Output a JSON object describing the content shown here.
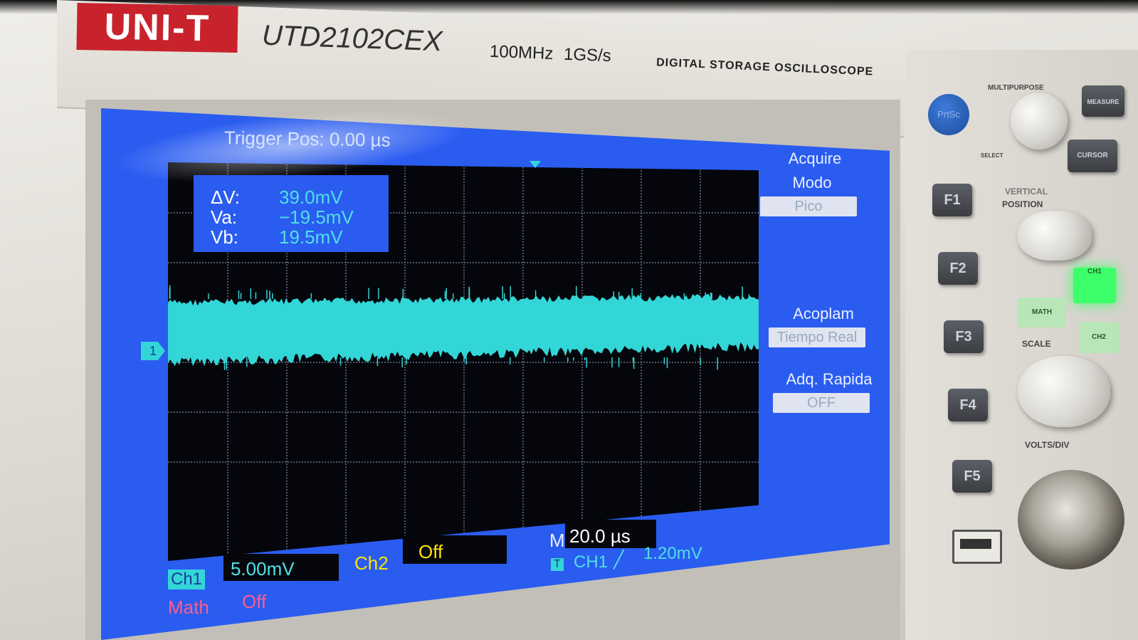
{
  "device": {
    "brand": "UNI-T",
    "model": "UTD2102CEX",
    "spec": "100MHz 1GS/s",
    "kind": "DIGITAL STORAGE OSCILLOSCOPE"
  },
  "screen": {
    "trigger_time": "Trigger Pos: 0.00 µs",
    "cursor": {
      "dv_label": "ΔV:",
      "dv_value": "39.0mV",
      "va_label": "Va:",
      "va_value": "−19.5mV",
      "vb_label": "Vb:",
      "vb_value": "19.5mV"
    },
    "menu": {
      "title": "Acquire",
      "mode_label": "Modo",
      "mode_value": "Pico",
      "coupling_label": "Acoplam",
      "coupling_value": "Tiempo Real",
      "fast_label": "Adq. Rapida",
      "fast_value": "OFF"
    },
    "status": {
      "ch1_label": "Ch1",
      "ch1_scale": "5.00mV",
      "ch2_label": "Ch2",
      "ch2_value": "Off",
      "math_label": "Math",
      "math_value": "Off",
      "timebase_prefix": "M",
      "timebase_value": "20.0 µs",
      "trigger_marker": "T",
      "trigger_source": "CH1",
      "trigger_level": "1.20mV"
    },
    "channel_marker": "1",
    "colors": {
      "screen_bg": "#2a5cf0",
      "trace": "#33d6d6",
      "ch1_text": "#4fe0e6",
      "ch2_text": "#ffe400",
      "math_text": "#ff5c8a"
    }
  },
  "panel": {
    "prtsc": "PrtSc",
    "multipurpose": "MULTIPURPOSE",
    "select": "SELECT",
    "measure": "MEASURE",
    "cursor": "CURSOR",
    "vertical": "VERTICAL",
    "position": "POSITION",
    "scale": "SCALE",
    "volts_div": "VOLTS/DIV",
    "math": "MATH",
    "ch1": "CH1",
    "ch2": "CH2",
    "f_keys": [
      "F1",
      "F2",
      "F3",
      "F4",
      "F5"
    ]
  }
}
